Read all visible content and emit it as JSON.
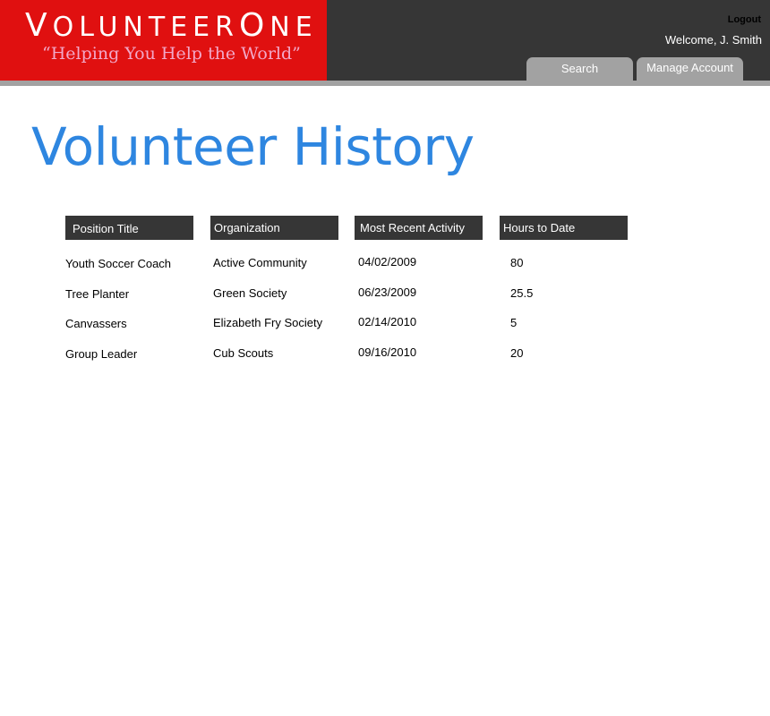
{
  "brand": {
    "logo_text": "VOLUNTEERONE",
    "tagline": "“Helping You Help the World”",
    "color": "#e01010"
  },
  "header": {
    "logout_label": "Logout",
    "welcome_text": "Welcome, J. Smith",
    "tabs": [
      {
        "label": "Search"
      },
      {
        "label": "Manage Account"
      }
    ]
  },
  "main": {
    "title": "Volunteer History",
    "title_color": "#2e86e0",
    "table": {
      "columns": [
        "Position Title",
        "Organization",
        "Most Recent Activity",
        "Hours to Date"
      ],
      "rows": [
        [
          "Youth Soccer Coach",
          "Active Community",
          "04/02/2009",
          "80"
        ],
        [
          "Tree Planter",
          "Green Society",
          "06/23/2009",
          "25.5"
        ],
        [
          "Canvassers",
          "Elizabeth Fry Society",
          "02/14/2010",
          "5"
        ],
        [
          "Group Leader",
          "Cub Scouts",
          "09/16/2010",
          "20"
        ]
      ]
    }
  }
}
